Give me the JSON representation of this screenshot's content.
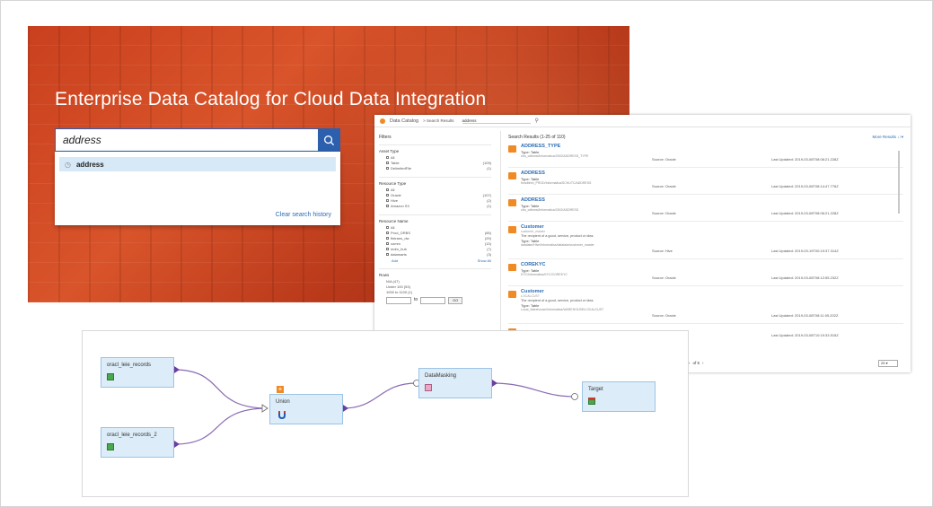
{
  "hero": {
    "title": "Enterprise Data Catalog for Cloud Data Integration",
    "search_value": "address",
    "suggestion": "address",
    "clear_history": "Clear search history"
  },
  "catalog": {
    "app_name": "Data Catalog",
    "breadcrumb": "> Search Results",
    "query": "address",
    "filters": {
      "title": "Filters",
      "sections": [
        {
          "heading": "Asset Type",
          "rows": [
            {
              "label": "All",
              "count": ""
            },
            {
              "label": "Table",
              "count": "(109)"
            },
            {
              "label": "DelimitedFile",
              "count": "(1)"
            }
          ]
        },
        {
          "heading": "Resource Type",
          "rows": [
            {
              "label": "All",
              "count": ""
            },
            {
              "label": "Oracle",
              "count": "(107)"
            },
            {
              "label": "Hive",
              "count": "(2)"
            },
            {
              "label": "Amazon S3",
              "count": "(1)"
            }
          ]
        },
        {
          "heading": "Resource Name",
          "rows": [
            {
              "label": "All",
              "count": ""
            },
            {
              "label": "Prod_ORBS",
              "count": "(65)"
            },
            {
              "label": "fintrans_dw",
              "count": "(29)"
            },
            {
              "label": "comm",
              "count": "(13)"
            },
            {
              "label": "mdm_hub",
              "count": "(7)"
            },
            {
              "label": "datamarts",
              "count": "(3)"
            }
          ],
          "add": "Add",
          "show_all": "Show All"
        },
        {
          "heading": "Rows",
          "rows": [
            {
              "label": "N/A (47)",
              "count": ""
            },
            {
              "label": "Under 100 (53)",
              "count": ""
            },
            {
              "label": "1000 to 1100 (1)",
              "count": ""
            }
          ],
          "range_to": "to",
          "go": "GO"
        }
      ]
    },
    "results": {
      "count": "Search Results (1-25 of 110)",
      "more": "More Results",
      "sort_icon": "sort-icon",
      "items": [
        {
          "name": "ADDRESS_TYPE",
          "sub": "",
          "desc": "",
          "type": "Type: Table",
          "path": "cbo_cdfsmsi/Informatica/CBO/ADDRESS_TYPE",
          "source": "Source: Oracle",
          "updated": "Last Updated: 2019-03-08T08:06:21.228Z"
        },
        {
          "name": "ADDRESS",
          "sub": "",
          "desc": "",
          "type": "Type: Table",
          "path": "fsmdbhrb_PROD/Informatica/SCHUTC/ADDRESS",
          "source": "Source: Oracle",
          "updated": "Last Updated: 2019-03-08T08:14:47.776Z"
        },
        {
          "name": "ADDRESS",
          "sub": "",
          "desc": "",
          "type": "Type: Table",
          "path": "cbo_cdfsmsi/Informatica/CBO/ADDRESS",
          "source": "Source: Oracle",
          "updated": "Last Updated: 2019-03-08T08:06:21.228Z"
        },
        {
          "name": "Customer",
          "sub": "customer_master",
          "desc": "The recipient of a good, service, product or idea.",
          "type": "Type: Table",
          "path": "datalake/Hive/Informatica/datalake/customer_master",
          "source": "Source: Hive",
          "updated": "Last Updated: 2019-03-19T00:19:37.314Z"
        },
        {
          "name": "COREKYC",
          "sub": "",
          "desc": "",
          "type": "Type: Table",
          "path": "KYC/Informatica/KYC/COREKYC",
          "source": "Source: Oracle",
          "updated": "Last Updated: 2019-03-08T08:12:55.232Z"
        },
        {
          "name": "Customer",
          "sub": "LOCALCUST",
          "desc": "The recipient of a good, service, product or idea.",
          "type": "Type: Table",
          "path": "Local_Warehouse/Informatica/WAREHOUSE/LOCALCUST",
          "source": "Source: Oracle",
          "updated": "Last Updated: 2019-03-08T08:11:05.202Z"
        },
        {
          "name": "",
          "sub": "",
          "desc": "",
          "type": "",
          "path": "",
          "source": "",
          "updated": "Last Updated: 2019-03-08T10:19:33.515Z"
        }
      ],
      "pager": "of 5",
      "page_size": "25"
    }
  },
  "mapping": {
    "nodes": {
      "src1": "oracl_leie_records",
      "src2": "oracl_leie_records_2",
      "union": "Union",
      "masking": "DataMasking",
      "target": "Target"
    }
  }
}
